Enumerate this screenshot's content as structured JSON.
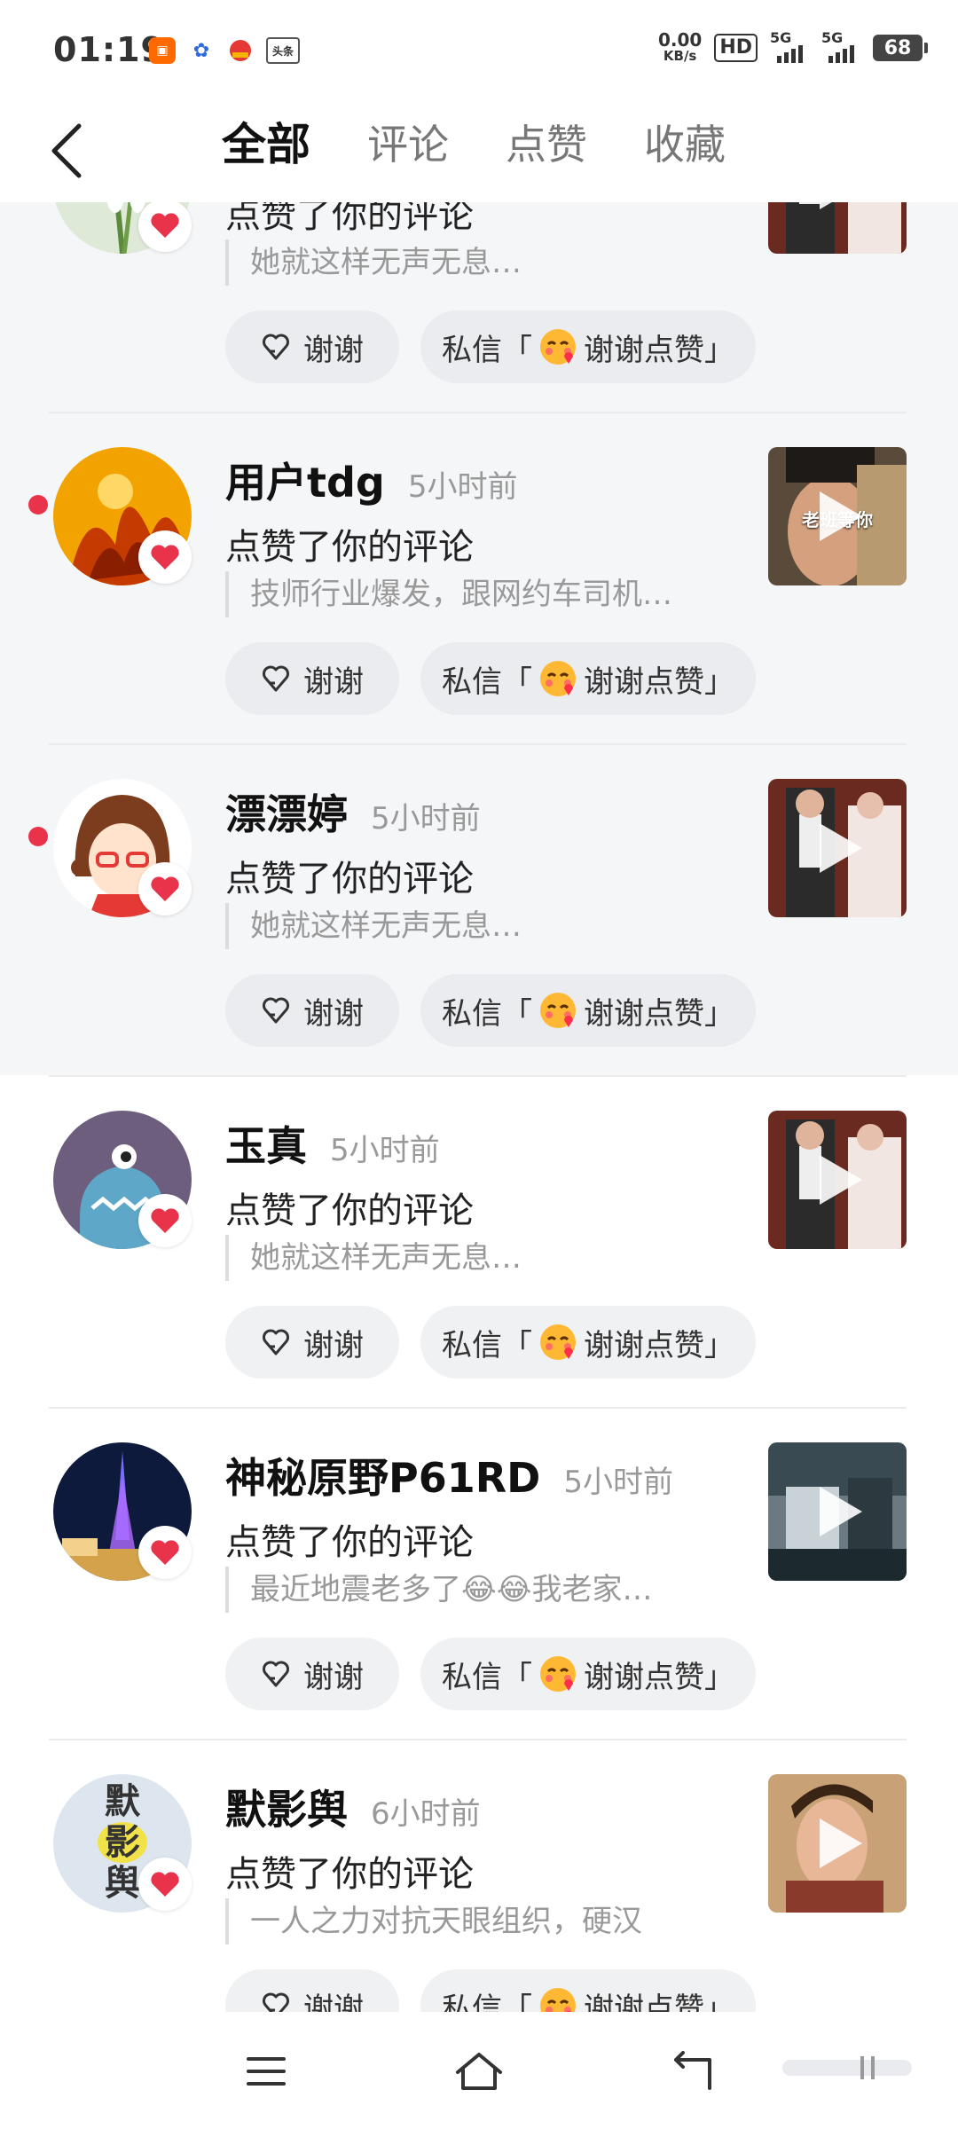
{
  "status_bar": {
    "time": "01:19",
    "net_speed_value": "0.00",
    "net_speed_unit": "KB/s",
    "hd_label": "HD",
    "signal1_label": "5G",
    "signal2_label": "5G",
    "battery": "68",
    "app_icons": [
      "kuaishou-icon",
      "baidu-icon",
      "news-icon",
      "toutiao-icon"
    ],
    "toutiao_label": "头条"
  },
  "nav": {
    "tabs": [
      {
        "label": "全部",
        "active": true
      },
      {
        "label": "评论",
        "active": false
      },
      {
        "label": "点赞",
        "active": false
      },
      {
        "label": "收藏",
        "active": false
      }
    ]
  },
  "notifications": [
    {
      "name": "",
      "time": "",
      "action": "点赞了你的评论",
      "quote": "她就这样无声无息…",
      "thumb_text": "",
      "unread": true,
      "thanks_label": "谢谢",
      "dm_prefix": "私信「",
      "dm_suffix": "谢谢点赞」"
    },
    {
      "name": "用户tdg",
      "time": "5小时前",
      "action": "点赞了你的评论",
      "quote": "技师行业爆发，跟网约车司机…",
      "thumb_text": "老班等你",
      "unread": true,
      "thanks_label": "谢谢",
      "dm_prefix": "私信「",
      "dm_suffix": "谢谢点赞」"
    },
    {
      "name": "漂漂婷",
      "time": "5小时前",
      "action": "点赞了你的评论",
      "quote": "她就这样无声无息…",
      "thumb_text": "",
      "unread": true,
      "thanks_label": "谢谢",
      "dm_prefix": "私信「",
      "dm_suffix": "谢谢点赞」"
    },
    {
      "name": "玉真",
      "time": "5小时前",
      "action": "点赞了你的评论",
      "quote": "她就这样无声无息…",
      "thumb_text": "",
      "unread": false,
      "thanks_label": "谢谢",
      "dm_prefix": "私信「",
      "dm_suffix": "谢谢点赞」"
    },
    {
      "name": "神秘原野P61RD",
      "time": "5小时前",
      "action": "点赞了你的评论",
      "quote": "最近地震老多了😂😂我老家…",
      "thumb_text": "",
      "unread": false,
      "thanks_label": "谢谢",
      "dm_prefix": "私信「",
      "dm_suffix": "谢谢点赞」"
    },
    {
      "name": "默影舆",
      "time": "6小时前",
      "action": "点赞了你的评论",
      "quote": "一人之力对抗天眼组织，硬汉",
      "thumb_text": "",
      "unread": false,
      "thanks_label": "谢谢",
      "dm_prefix": "私信「",
      "dm_suffix": "谢谢点赞」"
    }
  ],
  "avatar_text_6": {
    "c1": "默",
    "c2": "影",
    "c3": "舆"
  },
  "colors": {
    "unread_dot": "#e8334a",
    "like_heart": "#e8334a",
    "unread_bg": "#f5f6f8"
  },
  "system_nav": {
    "icons": [
      "menu-icon",
      "home-icon",
      "back-icon"
    ]
  }
}
